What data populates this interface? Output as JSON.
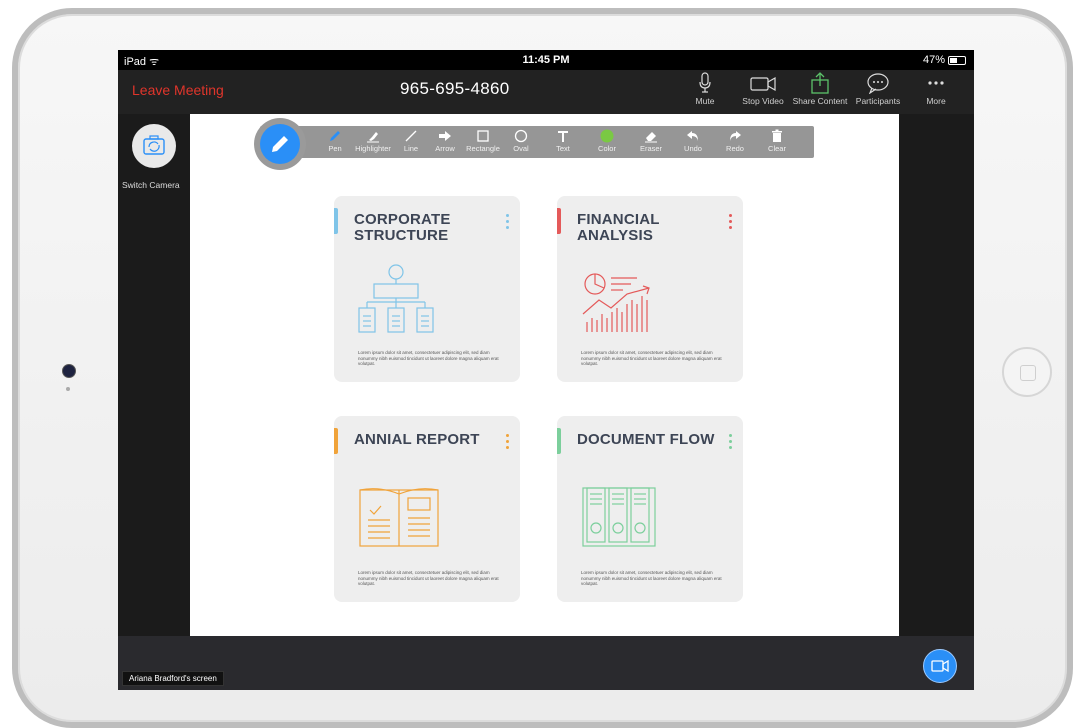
{
  "status_bar": {
    "device": "iPad",
    "time": "11:45 PM",
    "battery": "47%"
  },
  "meeting_bar": {
    "leave_label": "Leave Meeting",
    "meeting_number": "965-695-4860",
    "buttons": [
      {
        "label": "Mute",
        "icon": "microphone-icon"
      },
      {
        "label": "Stop Video",
        "icon": "video-camera-icon"
      },
      {
        "label": "Share Content",
        "icon": "share-upload-icon"
      },
      {
        "label": "Participants",
        "icon": "chat-bubble-icon"
      },
      {
        "label": "More",
        "icon": "more-dots-icon"
      }
    ]
  },
  "switch_camera": {
    "label": "Switch Camera",
    "icon": "switch-camera-icon"
  },
  "annotation_toolbar": {
    "tools": [
      {
        "label": "Pen",
        "icon": "pen-icon"
      },
      {
        "label": "Highlighter",
        "icon": "highlighter-icon"
      },
      {
        "label": "Line",
        "icon": "line-icon"
      },
      {
        "label": "Arrow",
        "icon": "arrow-icon"
      },
      {
        "label": "Rectangle",
        "icon": "rectangle-icon"
      },
      {
        "label": "Oval",
        "icon": "oval-icon"
      },
      {
        "label": "Text",
        "icon": "text-icon"
      },
      {
        "label": "Color",
        "icon": "color-dot-icon"
      },
      {
        "label": "Eraser",
        "icon": "eraser-icon"
      },
      {
        "label": "Undo",
        "icon": "undo-icon"
      },
      {
        "label": "Redo",
        "icon": "redo-icon"
      },
      {
        "label": "Clear",
        "icon": "trash-icon"
      }
    ],
    "active_color": "#7ac943"
  },
  "cards": [
    {
      "title": "CORPORATE\nSTRUCTURE",
      "accent": "#7fc4e8",
      "icon": "org-chart-icon",
      "desc": "Lorem ipsum dolor sit amet, consectetuer adipiscing elit, sed diam nonummy nibh euismod tincidunt ut laoreet dolore magna aliquam erat volutpat."
    },
    {
      "title": "FINANCIAL\nANALYSIS",
      "accent": "#e45a5a",
      "icon": "financial-chart-icon",
      "desc": "Lorem ipsum dolor sit amet, consectetuer adipiscing elit, sed diam nonummy nibh euismod tincidunt ut laoreet dolore magna aliquam erat volutpat."
    },
    {
      "title": "ANNIAL REPORT",
      "accent": "#f0a33a",
      "icon": "open-report-icon",
      "desc": "Lorem ipsum dolor sit amet, consectetuer adipiscing elit, sed diam nonummy nibh euismod tincidunt ut laoreet dolore magna aliquam erat volutpat."
    },
    {
      "title": "DOCUMENT FLOW",
      "accent": "#7ccf9c",
      "icon": "binders-icon",
      "desc": "Lorem ipsum dolor sit amet, consectetuer adipiscing elit, sed diam nonummy nibh euismod tincidunt ut laoreet dolore magna aliquam erat volutpat."
    }
  ],
  "screen_owner": "Ariana Bradford's screen",
  "colors": {
    "accent_blue": "#2a8ff7",
    "leave_red": "#e0352b",
    "share_green": "#5cc26a"
  }
}
